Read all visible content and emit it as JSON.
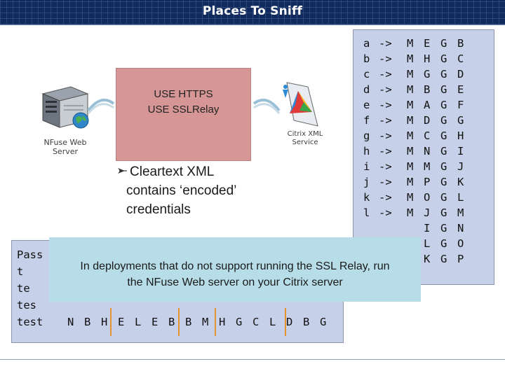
{
  "title": "Places To Sniff",
  "diagram": {
    "server_label": [
      "NFuse Web",
      "Server"
    ],
    "xml_label": [
      "Citrix XML",
      "Service"
    ],
    "box_lines": [
      "USE HTTPS",
      "USE SSLRelay"
    ],
    "server_icon": "web-server-icon",
    "xml_icon": "citrix-xml-service-icon",
    "arrow_icon": "double-arrow-icon"
  },
  "bullet": {
    "icon": "arrow-bullet-icon",
    "line1": "Cleartext XML",
    "line2": "contains ‘encoded’",
    "line3": "credentials"
  },
  "mapping": [
    {
      "letter": "a",
      "arrow": "->",
      "codes": [
        "M",
        "E",
        "G",
        "B"
      ]
    },
    {
      "letter": "b",
      "arrow": "->",
      "codes": [
        "M",
        "H",
        "G",
        "C"
      ]
    },
    {
      "letter": "c",
      "arrow": "->",
      "codes": [
        "M",
        "G",
        "G",
        "D"
      ]
    },
    {
      "letter": "d",
      "arrow": "->",
      "codes": [
        "M",
        "B",
        "G",
        "E"
      ]
    },
    {
      "letter": "e",
      "arrow": "->",
      "codes": [
        "M",
        "A",
        "G",
        "F"
      ]
    },
    {
      "letter": "f",
      "arrow": "->",
      "codes": [
        "M",
        "D",
        "G",
        "G"
      ]
    },
    {
      "letter": "g",
      "arrow": "->",
      "codes": [
        "M",
        "C",
        "G",
        "H"
      ]
    },
    {
      "letter": "h",
      "arrow": "->",
      "codes": [
        "M",
        "N",
        "G",
        "I"
      ]
    },
    {
      "letter": "i",
      "arrow": "->",
      "codes": [
        "M",
        "M",
        "G",
        "J"
      ]
    },
    {
      "letter": "j",
      "arrow": "->",
      "codes": [
        "M",
        "P",
        "G",
        "K"
      ]
    },
    {
      "letter": "k",
      "arrow": "->",
      "codes": [
        "M",
        "O",
        "G",
        "L"
      ]
    },
    {
      "letter": "l",
      "arrow": "->",
      "codes": [
        "M",
        "J",
        "G",
        "M"
      ]
    },
    {
      "letter": "",
      "arrow": "",
      "codes": [
        "",
        "I",
        "G",
        "N"
      ]
    },
    {
      "letter": "",
      "arrow": "",
      "codes": [
        "",
        "L",
        "G",
        "O"
      ]
    },
    {
      "letter": "",
      "arrow": "",
      "codes": [
        "",
        "K",
        "G",
        "P"
      ]
    }
  ],
  "password_rows": [
    "Pass",
    "t",
    "te",
    "tes",
    "test"
  ],
  "encoded": [
    "N",
    "B",
    "H",
    "E",
    "L",
    "E",
    "B",
    "B",
    "M",
    "H",
    "G",
    "C",
    "L",
    "D",
    "B",
    "G"
  ],
  "note": {
    "line1": "In deployments that do not support running the SSL Relay, run",
    "line2": "the NFuse Web server on your Citrix server"
  },
  "colors": {
    "title_bar": "#102a5e",
    "use_box": "#d69696",
    "code_panel": "#c6d0e8",
    "note": "#b7dde8",
    "separator": "#e8922e"
  }
}
